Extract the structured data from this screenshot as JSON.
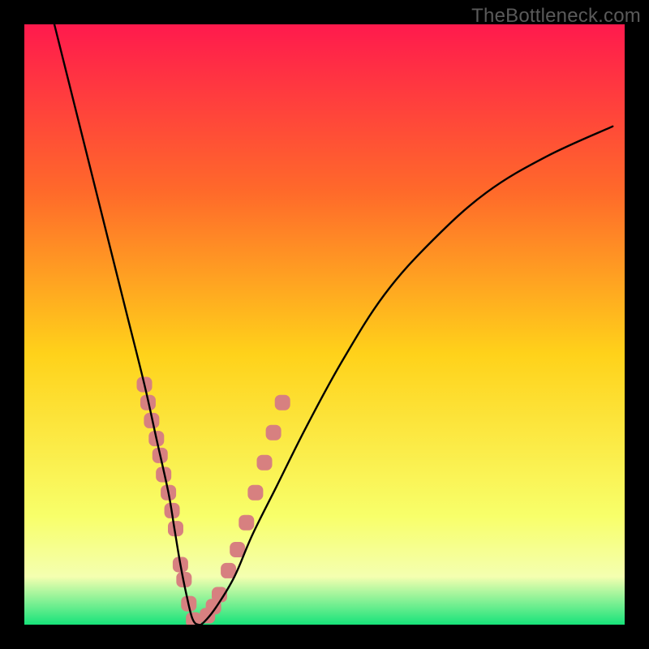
{
  "watermark": "TheBottleneck.com",
  "gradient_colors": {
    "top": "#ff1a4d",
    "mid_upper": "#ff6a2a",
    "mid": "#ffd21a",
    "mid_lower": "#f8ff6a",
    "band_pale": "#f4ffb0",
    "bottom": "#17e37a"
  },
  "chart_data": {
    "type": "line",
    "title": "",
    "xlabel": "",
    "ylabel": "",
    "xlim": [
      0,
      100
    ],
    "ylim": [
      0,
      100
    ],
    "series": [
      {
        "name": "bottleneck-curve",
        "x": [
          5,
          8,
          11,
          14,
          17,
          20,
          22,
          24,
          25,
          26,
          27,
          28,
          29,
          30,
          32,
          35,
          38,
          42,
          47,
          53,
          60,
          68,
          77,
          87,
          98
        ],
        "y": [
          100,
          88,
          76,
          64,
          52,
          40,
          31,
          22,
          16,
          10,
          5,
          1,
          0,
          0.5,
          3,
          8,
          15,
          23,
          33,
          44,
          55,
          64,
          72,
          78,
          83
        ]
      }
    ],
    "markers": [
      {
        "name": "left-branch-markers",
        "x": [
          20.0,
          20.6,
          21.2,
          22.0,
          22.6,
          23.2,
          24.0,
          24.6,
          25.2,
          26.0,
          26.6,
          27.4,
          28.2
        ],
        "y": [
          40.0,
          37.0,
          34.0,
          31.0,
          28.2,
          25.0,
          22.0,
          19.0,
          16.0,
          10.0,
          7.5,
          3.5,
          0.8
        ]
      },
      {
        "name": "right-branch-markers",
        "x": [
          30.5,
          31.5,
          32.5,
          34.0,
          35.5,
          37.0,
          38.5,
          40.0,
          41.5,
          43.0
        ],
        "y": [
          1.5,
          3.0,
          5.0,
          9.0,
          12.5,
          17.0,
          22.0,
          27.0,
          32.0,
          37.0
        ]
      }
    ],
    "marker_style": {
      "size": 19,
      "color": "#d78080",
      "shape": "rounded-square"
    }
  }
}
